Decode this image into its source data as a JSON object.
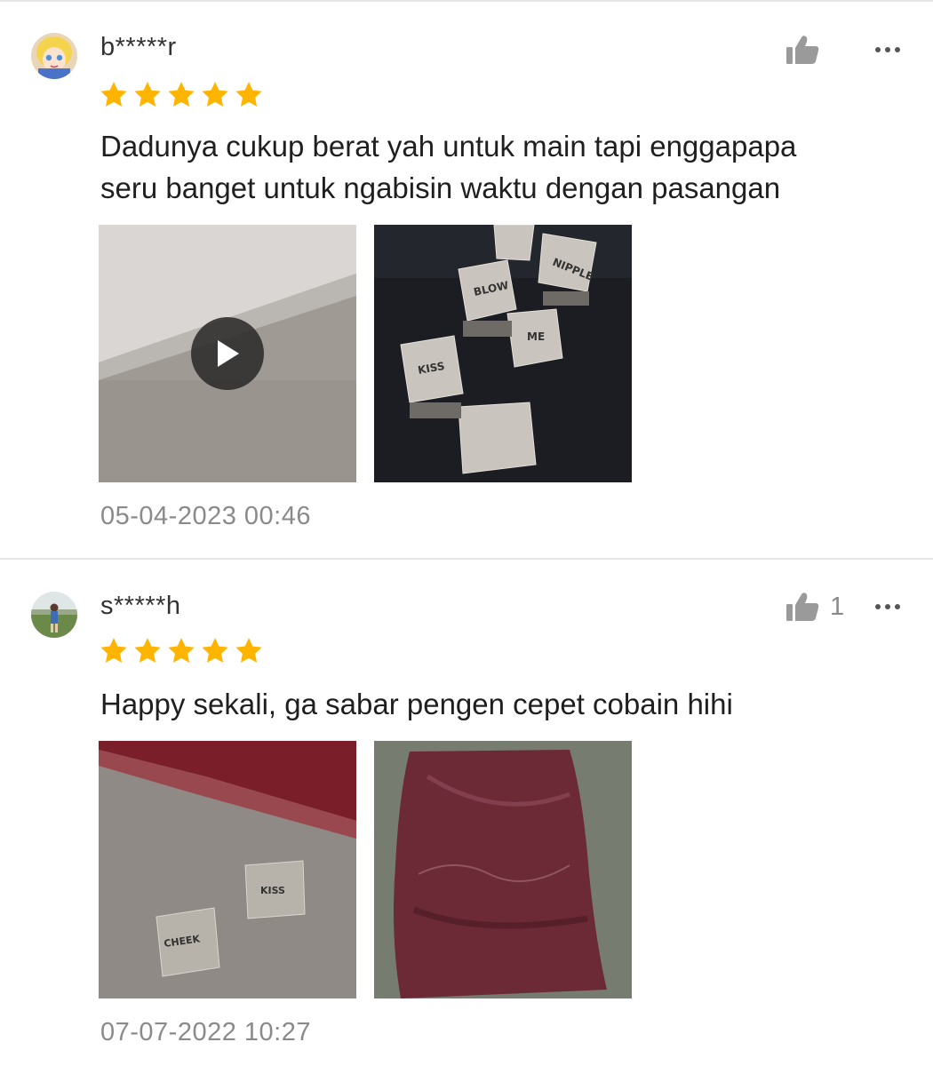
{
  "reviews": [
    {
      "username": "b*****r",
      "rating": 5,
      "text_line1": "Dadunya cukup berat yah untuk main tapi enggapapa",
      "text_line2": "seru banget untuk ngabisin waktu dengan pasangan",
      "images": [
        {
          "kind": "video",
          "icon": "play-icon"
        },
        {
          "kind": "photo",
          "labels": [
            "BLOW",
            "NIPPLE",
            "ME",
            "KISS"
          ]
        }
      ],
      "date": "05-04-2023 00:46",
      "likes": ""
    },
    {
      "username": "s*****h",
      "rating": 5,
      "text_line1": "Happy sekali, ga sabar pengen cepet cobain hihi",
      "images": [
        {
          "kind": "photo",
          "labels": [
            "KISS",
            "CHEEK"
          ]
        },
        {
          "kind": "photo",
          "labels": []
        }
      ],
      "date": "07-07-2022 10:27",
      "likes": "1"
    }
  ],
  "colors": {
    "star": "#FFB400",
    "muted": "#8a8a8a",
    "icon": "#9a9a9a"
  },
  "icons": [
    "thumbs-up-icon",
    "more-icon",
    "star-icon",
    "play-icon"
  ]
}
